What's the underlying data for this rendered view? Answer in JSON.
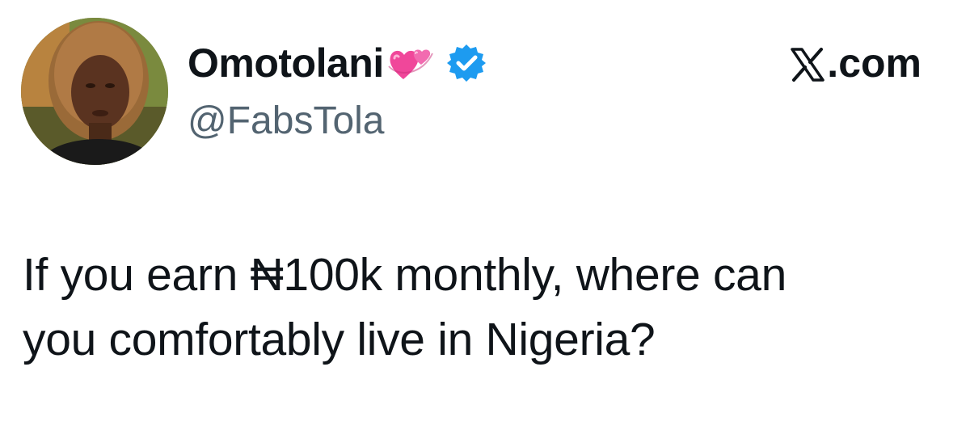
{
  "author": {
    "display_name": "Omotolani",
    "emoji": "revolving-hearts-icon",
    "handle": "@FabsTola",
    "verified": true
  },
  "brand": {
    "label": ".com",
    "logo": "x-logo-icon"
  },
  "tweet": {
    "lines": [
      "If you earn ₦100k monthly, where can",
      "you comfortably live in Nigeria?"
    ]
  },
  "colors": {
    "text": "#0f1419",
    "secondary_text": "#536471",
    "verified_badge": "#1d9bf0",
    "emoji_pink": "#f0479a"
  }
}
